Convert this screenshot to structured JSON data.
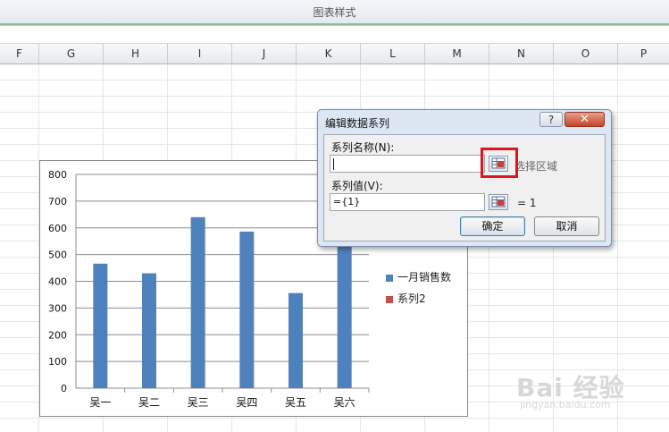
{
  "ribbon": {
    "title": "图表样式"
  },
  "columns": [
    "F",
    "G",
    "H",
    "I",
    "J",
    "K",
    "L",
    "M",
    "N",
    "O",
    "P"
  ],
  "chart_data": {
    "type": "bar",
    "categories": [
      "吴一",
      "吴二",
      "吴三",
      "吴四",
      "吴五",
      "吴六"
    ],
    "series": [
      {
        "name": "一月销售数",
        "values": [
          466,
          430,
          640,
          586,
          356,
          540
        ],
        "color": "#4f81bd"
      },
      {
        "name": "系列2",
        "values": [],
        "color": "#c0504d"
      }
    ],
    "ylim": [
      0,
      800
    ],
    "yticks": [
      0,
      100,
      200,
      300,
      400,
      500,
      600,
      700,
      800
    ],
    "legend_position": "right",
    "grid": true
  },
  "dialog": {
    "title": "编辑数据系列",
    "help_label": "?",
    "close_label": "✕",
    "name_label": "系列名称(N):",
    "name_value": "",
    "select_range_text": "选择区域",
    "values_label": "系列值(V):",
    "values_value": "={1}",
    "values_preview": "= 1",
    "ok_label": "确定",
    "cancel_label": "取消"
  },
  "watermark": {
    "text": "Bai 经验",
    "url": "jingyan.baidu.com"
  }
}
